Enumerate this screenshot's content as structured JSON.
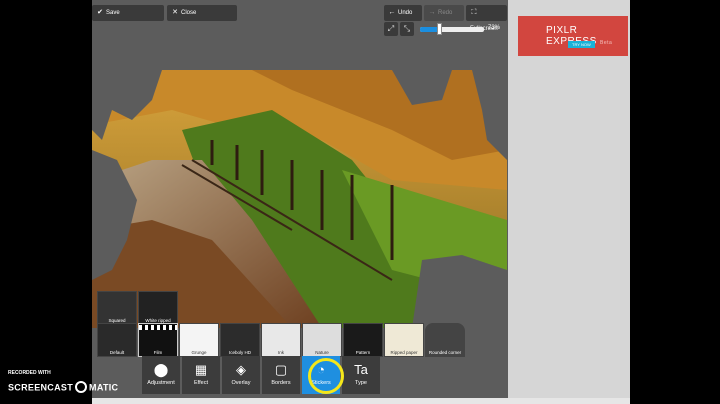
{
  "toolbar_top": {
    "save": "Save",
    "close": "Close",
    "undo": "Undo",
    "redo": "Redo",
    "fullscreen": "Fullscreen",
    "zoom_value": "73%",
    "zoom_fraction": 0.3
  },
  "ad": {
    "brand": "PIXLR EXPRESS",
    "brand_suffix": "Beta",
    "cta": "TRY NOW"
  },
  "borders": {
    "row1": [
      "Squared",
      "White ripped"
    ],
    "row2": [
      "Default",
      "Film",
      "Grunge",
      "Iceboly HD",
      "Ink",
      "Nature",
      "Pattern",
      "Ripped paper",
      "Rounded corner"
    ]
  },
  "tools": [
    {
      "label": "Adjustment",
      "icon": "toggle-icon"
    },
    {
      "label": "Effect",
      "icon": "film-icon"
    },
    {
      "label": "Overlay",
      "icon": "layers-icon"
    },
    {
      "label": "Borders",
      "icon": "frame-icon"
    },
    {
      "label": "Stickers",
      "icon": "sticker-icon"
    },
    {
      "label": "Type",
      "icon": "type-icon"
    }
  ],
  "watermark": {
    "line1": "RECORDED WITH",
    "line2a": "SCREENCAST",
    "line2b": "MATIC"
  },
  "colors": {
    "accent": "#1f8fe0",
    "ad": "#d2463f",
    "highlight": "#f5e71a"
  }
}
